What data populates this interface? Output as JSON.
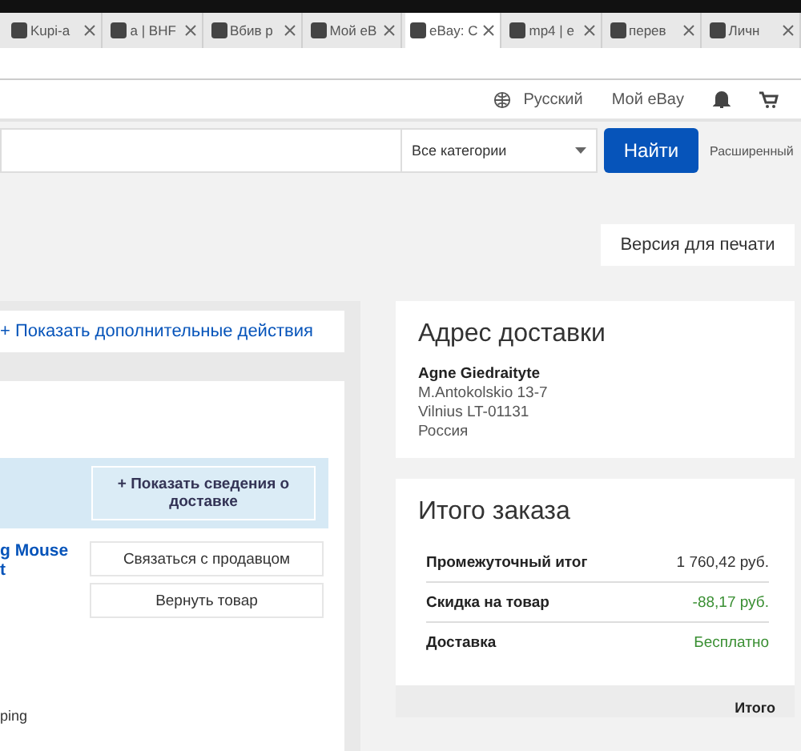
{
  "tabs": [
    {
      "label": "Kupi-a",
      "selected": false
    },
    {
      "label": "a | BHF",
      "selected": false
    },
    {
      "label": "Вбив р",
      "selected": false
    },
    {
      "label": "Мой eB",
      "selected": false
    },
    {
      "label": "eBay: C",
      "selected": true
    },
    {
      "label": "mp4 | e",
      "selected": false
    },
    {
      "label": "перев",
      "selected": false
    },
    {
      "label": "Личн",
      "selected": false
    }
  ],
  "header": {
    "language": "Русский",
    "my_ebay": "Мой eBay"
  },
  "search": {
    "category": "Все категории",
    "button": "Найти",
    "advanced": "Расширенный"
  },
  "print_button": "Версия для печати",
  "order": {
    "more_actions": "+ Показать дополнительные действия",
    "shipping_details": "+ Показать сведения о доставке",
    "item_title": "g Mouse\nt",
    "contact_seller": "Связаться с продавцом",
    "return_item": "Вернуть товар",
    "shipping_note": "ping"
  },
  "address": {
    "title": "Адрес доставки",
    "lines": [
      "Agne Giedraityte",
      "M.Antokolskio 13-7",
      "Vilnius LT-01131",
      "Россия"
    ]
  },
  "summary": {
    "title": "Итого заказа",
    "rows": [
      {
        "label": "Промежуточный итог",
        "value": "1 760,42 руб.",
        "kind": "plain"
      },
      {
        "label": "Скидка на товар",
        "value": "-88,17 руб.",
        "kind": "credit"
      },
      {
        "label": "Доставка",
        "value": "Бесплатно",
        "kind": "credit"
      }
    ],
    "total_label": "Итого"
  }
}
